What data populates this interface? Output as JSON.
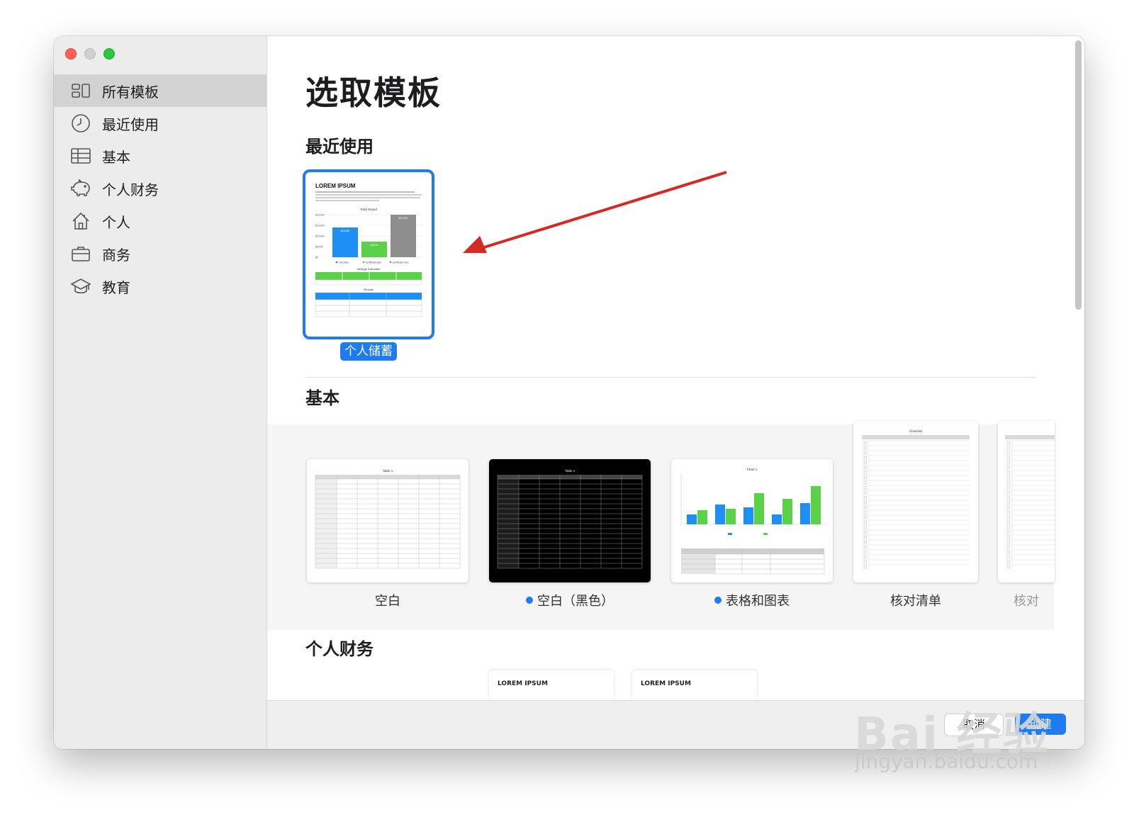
{
  "sidebar": {
    "items": [
      {
        "label": "所有模板",
        "icon": "grid-icon",
        "active": true
      },
      {
        "label": "最近使用",
        "icon": "clock-icon",
        "active": false
      },
      {
        "label": "基本",
        "icon": "table-icon",
        "active": false
      },
      {
        "label": "个人财务",
        "icon": "piggy-bank-icon",
        "active": false
      },
      {
        "label": "个人",
        "icon": "house-icon",
        "active": false
      },
      {
        "label": "商务",
        "icon": "briefcase-icon",
        "active": false
      },
      {
        "label": "教育",
        "icon": "graduation-cap-icon",
        "active": false
      }
    ]
  },
  "main": {
    "title": "选取模板",
    "recent": {
      "heading": "最近使用",
      "template": {
        "label": "个人储蓄",
        "doc_title": "LOREM IPSUM",
        "chart_title": "Total Saved",
        "bar_labels": [
          "$15,000",
          "$6,000",
          "$21,000"
        ],
        "y_ticks": [
          "$20,000",
          "$15,000",
          "$10,000",
          "$5,000",
          "$0"
        ],
        "legend": [
          "Your data",
          "Certificate data",
          "Certificate more"
        ],
        "calc_title": "Savings Calculator",
        "results_title": "Results"
      }
    },
    "basic": {
      "heading": "基本",
      "templates": [
        {
          "label": "空白",
          "dot": false,
          "thumb_title": "Table 1"
        },
        {
          "label": "空白（黑色）",
          "dot": true,
          "thumb_title": "Table 1"
        },
        {
          "label": "表格和图表",
          "dot": true,
          "thumb_title": "Chart 1"
        },
        {
          "label": "核对清单",
          "dot": false,
          "thumb_title": "Checklist"
        },
        {
          "label": "核对",
          "dot": false,
          "thumb_title": "Checklist"
        }
      ]
    },
    "personal_finance": {
      "heading": "个人财务",
      "cards": [
        {
          "title": "LOREM IPSUM"
        },
        {
          "title": "LOREM IPSUM"
        }
      ]
    }
  },
  "footer": {
    "cancel_label": "取消",
    "create_label": "创建"
  },
  "watermark": {
    "brand": "Bai 经验",
    "url": "jingyan.baidu.com"
  },
  "colors": {
    "accent": "#1e7cf0",
    "arrow": "#d42a22",
    "chart_blue": "#1e90f5",
    "chart_green": "#5bd14a",
    "chart_gray": "#8e8e8e"
  }
}
